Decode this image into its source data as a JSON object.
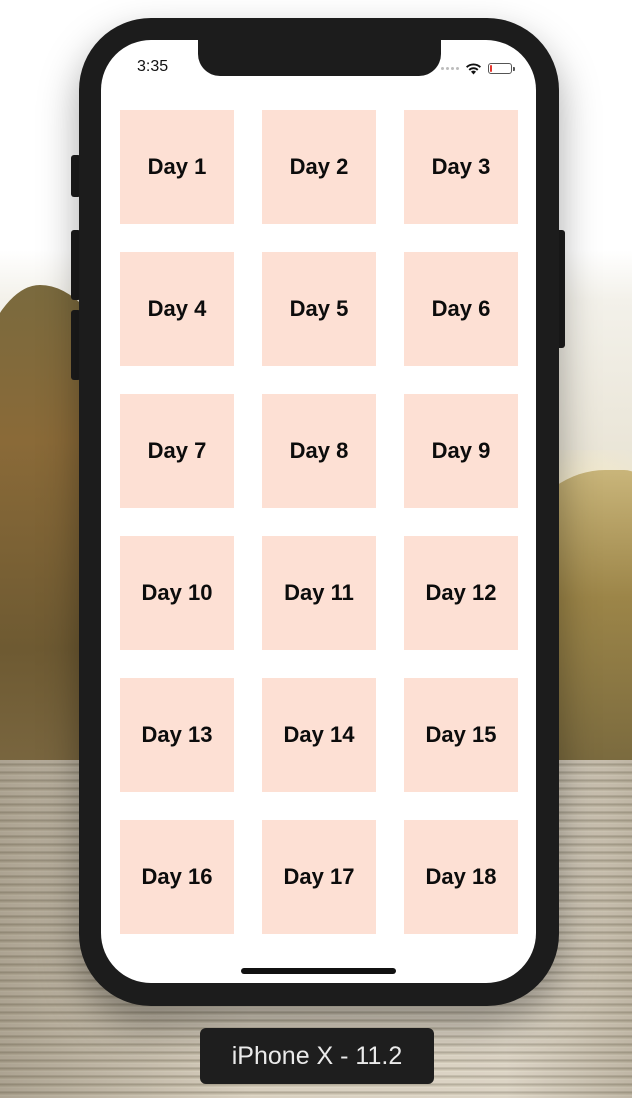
{
  "status_bar": {
    "time": "3:35",
    "battery_level": 0.12,
    "battery_color": "#e5372e"
  },
  "days": [
    "Day 1",
    "Day 2",
    "Day 3",
    "Day 4",
    "Day 5",
    "Day 6",
    "Day 7",
    "Day 8",
    "Day 9",
    "Day 10",
    "Day 11",
    "Day 12",
    "Day 13",
    "Day 14",
    "Day 15",
    "Day 16",
    "Day 17",
    "Day 18"
  ],
  "tile_color": "#fde0d4",
  "device_label": "iPhone X - 11.2",
  "icons": {
    "wifi": "wifi-icon",
    "battery": "battery-icon",
    "signal": "signal-icon"
  }
}
